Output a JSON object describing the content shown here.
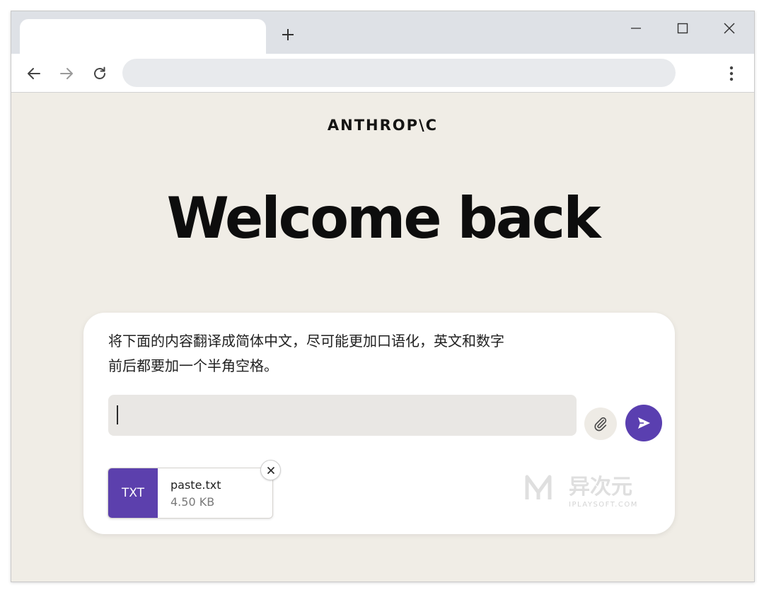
{
  "browser": {
    "tab_title": "",
    "address": "",
    "icons": {
      "new_tab": "plus-icon",
      "minimize": "minimize-icon",
      "maximize": "maximize-icon",
      "close": "close-icon",
      "back": "arrow-left-icon",
      "forward": "arrow-right-icon",
      "reload": "reload-icon",
      "menu": "kebab-menu-icon"
    }
  },
  "page": {
    "brand": "ANTHROP\\C",
    "heading": "Welcome back",
    "prompt_lines": [
      "将下面的内容翻译成简体中文，尽可能更加口语化，英文和数字",
      "前后都要加一个半角空格。"
    ],
    "input_value": "",
    "attachment": {
      "type": "TXT",
      "name": "paste.txt",
      "size": "4.50 KB"
    },
    "watermark": {
      "cn": "异次元",
      "en": "IPLAYSOFT.COM"
    },
    "icons": {
      "attach": "paperclip-icon",
      "send": "send-icon",
      "remove": "close-icon"
    }
  },
  "colors": {
    "page_bg": "#f0ede6",
    "accent": "#5a3fb0",
    "tabstrip_bg": "#dee1e6"
  }
}
